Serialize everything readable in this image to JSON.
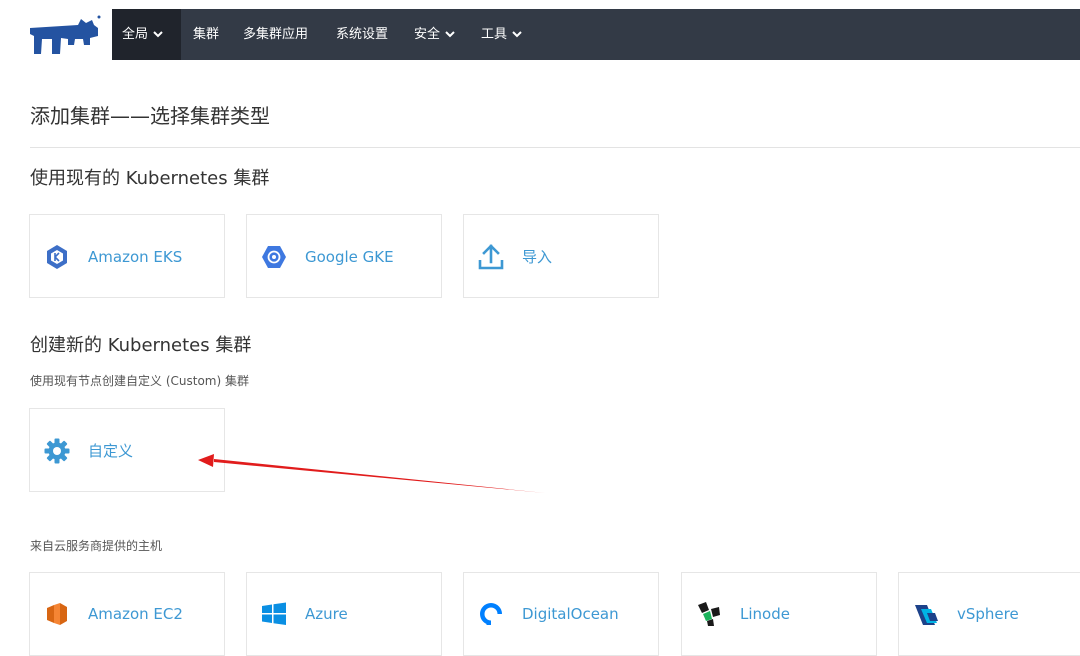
{
  "nav": {
    "items": [
      {
        "label": "全局",
        "dropdown": true,
        "active": true
      },
      {
        "label": "集群",
        "dropdown": false
      },
      {
        "label": "多集群应用",
        "dropdown": false
      },
      {
        "label": "系统设置",
        "dropdown": false
      },
      {
        "label": "安全",
        "dropdown": true
      },
      {
        "label": "工具",
        "dropdown": true
      }
    ],
    "logo_icon": "rancher-cow-icon"
  },
  "page_title": "添加集群——选择集群类型",
  "existing": {
    "heading": "使用现有的 Kubernetes 集群",
    "cards": [
      {
        "label": "Amazon EKS",
        "icon": "eks-icon"
      },
      {
        "label": "Google GKE",
        "icon": "gke-icon"
      },
      {
        "label": "导入",
        "icon": "upload-icon"
      }
    ]
  },
  "create": {
    "heading": "创建新的 Kubernetes 集群",
    "custom_subheading": "使用现有节点创建自定义 (Custom) 集群",
    "custom_card": {
      "label": "自定义",
      "icon": "gear-icon"
    },
    "cloud_subheading": "来自云服务商提供的主机",
    "cloud_cards": [
      {
        "label": "Amazon EC2",
        "icon": "ec2-icon"
      },
      {
        "label": "Azure",
        "icon": "azure-icon"
      },
      {
        "label": "DigitalOcean",
        "icon": "digitalocean-icon"
      },
      {
        "label": "Linode",
        "icon": "linode-icon"
      },
      {
        "label": "vSphere",
        "icon": "vsphere-icon"
      }
    ]
  },
  "colors": {
    "navbar": "#333a46",
    "navbar_active": "#20242c",
    "link_blue": "#3d98d3",
    "annotation_arrow": "#e11c1c"
  }
}
